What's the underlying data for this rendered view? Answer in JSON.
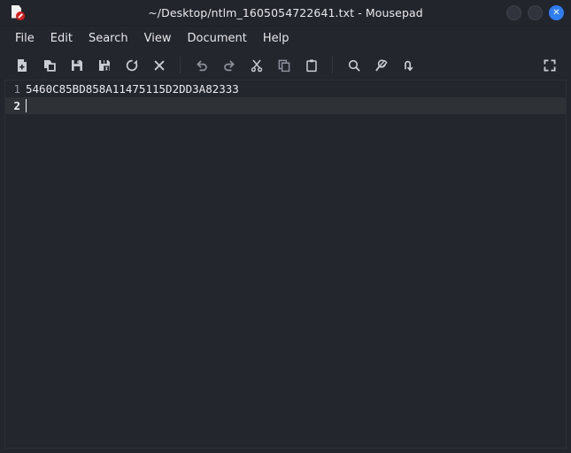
{
  "window": {
    "title": "~/Desktop/ntlm_1605054722641.txt - Mousepad",
    "app_icon": "document-edit-icon",
    "controls": {
      "minimize_label": "",
      "maximize_label": "",
      "close_label": "✕"
    },
    "colors": {
      "titlebar_bg": "#22252c",
      "chrome_bg": "#23262d",
      "editor_bg": "#23262d",
      "current_line_bg": "#2e3136",
      "close_button": "#2e7df2",
      "text": "#e9ebef",
      "gutter_text": "#8f96a3",
      "icon": "#c9ccd3",
      "icon_dim": "#8d919b"
    }
  },
  "menubar": {
    "items": [
      {
        "label": "File"
      },
      {
        "label": "Edit"
      },
      {
        "label": "Search"
      },
      {
        "label": "View"
      },
      {
        "label": "Document"
      },
      {
        "label": "Help"
      }
    ]
  },
  "toolbar": {
    "groups": [
      {
        "buttons": [
          {
            "icon": "new-document-icon",
            "label": "New"
          },
          {
            "icon": "open-document-icon",
            "label": "Open"
          },
          {
            "icon": "save-icon",
            "label": "Save"
          },
          {
            "icon": "save-as-icon",
            "label": "Save As"
          },
          {
            "icon": "reload-icon",
            "label": "Reload"
          },
          {
            "icon": "close-document-icon",
            "label": "Close"
          }
        ]
      },
      {
        "buttons": [
          {
            "icon": "undo-icon",
            "label": "Undo"
          },
          {
            "icon": "redo-icon",
            "label": "Redo"
          },
          {
            "icon": "cut-icon",
            "label": "Cut"
          },
          {
            "icon": "copy-icon",
            "label": "Copy"
          },
          {
            "icon": "paste-icon",
            "label": "Paste"
          }
        ]
      },
      {
        "buttons": [
          {
            "icon": "search-icon",
            "label": "Find"
          },
          {
            "icon": "find-replace-icon",
            "label": "Find and Replace"
          },
          {
            "icon": "go-to-line-icon",
            "label": "Go to Line"
          }
        ]
      }
    ],
    "fullscreen": {
      "icon": "fullscreen-icon",
      "label": "Fullscreen"
    }
  },
  "editor": {
    "lines": [
      {
        "number": "1",
        "text": "5460C85BD858A11475115D2DD3A82333",
        "current": false
      },
      {
        "number": "2",
        "text": "",
        "current": true
      }
    ]
  }
}
